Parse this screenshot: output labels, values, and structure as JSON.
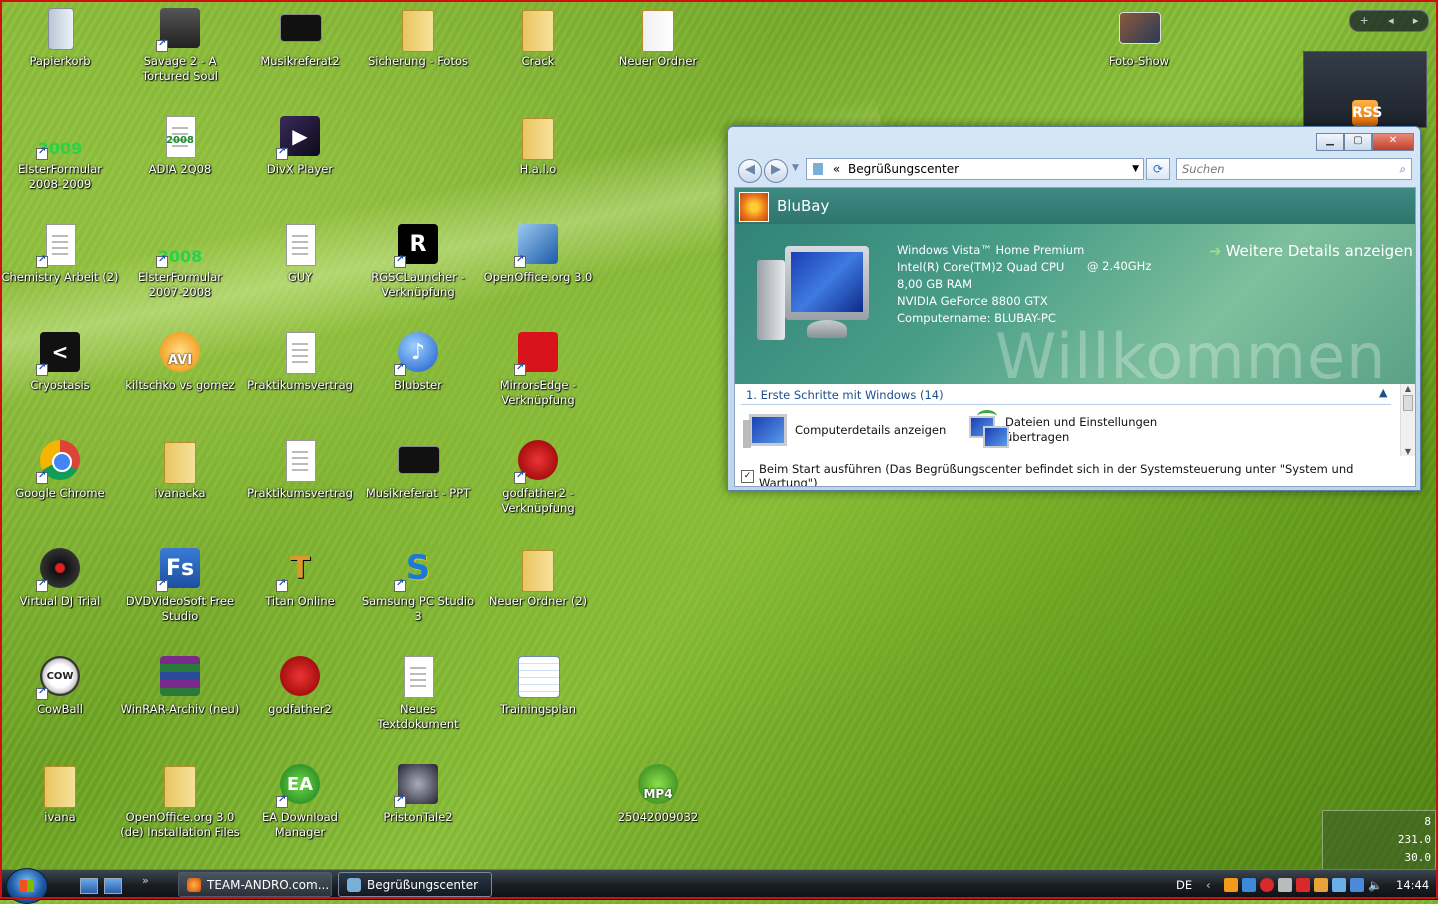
{
  "desktop": {
    "icons": [
      {
        "label": "Papierkorb"
      },
      {
        "label": "Savage 2 - A Tortured Soul"
      },
      {
        "label": "Musikreferat2"
      },
      {
        "label": "Sicherung - Fotos"
      },
      {
        "label": "Crack"
      },
      {
        "label": "Neuer Ordner"
      },
      {
        "label": "Foto-Show"
      },
      {
        "label": "ElsterFormular 2008-2009"
      },
      {
        "label": "ADIA 2Q08"
      },
      {
        "label": "DivX Player"
      },
      {
        "label": "H.a.l.o"
      },
      {
        "label": "Chemistry Arbeit (2)"
      },
      {
        "label": "ElsterFormular 2007-2008"
      },
      {
        "label": "GUY"
      },
      {
        "label": "RGSCLauncher - Verknüpfung"
      },
      {
        "label": "OpenOffice.org 3.0"
      },
      {
        "label": "Cryostasis"
      },
      {
        "label": "kiltschko vs gomez"
      },
      {
        "label": "Praktikumsvertrag"
      },
      {
        "label": "Blubster"
      },
      {
        "label": "MirrorsEdge - Verknüpfung"
      },
      {
        "label": "Google Chrome"
      },
      {
        "label": "ivanacka"
      },
      {
        "label": "Praktikumsvertrag"
      },
      {
        "label": "Musikreferat - PPT"
      },
      {
        "label": "godfather2 - Verknüpfung"
      },
      {
        "label": "Virtual DJ Trial"
      },
      {
        "label": "DVDVideoSoft Free Studio"
      },
      {
        "label": "Titan Online"
      },
      {
        "label": "Samsung PC Studio 3"
      },
      {
        "label": "Neuer Ordner (2)"
      },
      {
        "label": "CowBall"
      },
      {
        "label": "WinRAR-Archiv (neu)"
      },
      {
        "label": "godfather2"
      },
      {
        "label": "Neues Textdokument"
      },
      {
        "label": "Trainingsplan"
      },
      {
        "label": "ivana"
      },
      {
        "label": "OpenOffice.org 3.0 (de) Installation Files"
      },
      {
        "label": "EA Download Manager"
      },
      {
        "label": "PristonTale2"
      },
      {
        "label": "25042009032"
      }
    ],
    "icon_glyphs": {
      "elster_year_1": "2009",
      "adia_year": "2008",
      "elster_year_2": "2008",
      "avi": "AVI",
      "fs": "Fs",
      "mp4": "MP4",
      "cow": "COW",
      "ea": "EA"
    }
  },
  "window": {
    "title": "Begrüßungscenter",
    "address_prefix": "«",
    "address": "Begrüßungscenter",
    "search_placeholder": "Suchen",
    "user_name": "BluBay",
    "specs": {
      "os": "Windows Vista™ Home Premium",
      "cpu": "Intel(R) Core(TM)2 Quad CPU",
      "cpu_speed": "@ 2.40GHz",
      "ram": "8,00 GB RAM",
      "gpu": "NVIDIA GeForce 8800 GTX",
      "computer_name": "Computername: BLUBAY-PC"
    },
    "more_details": "Weitere Details anzeigen",
    "watermark": "Willkommen",
    "section_title": "1. Erste Schritte mit Windows (14)",
    "tasks": [
      {
        "label": "Computerdetails anzeigen"
      },
      {
        "label": "Dateien und Einstellungen übertragen"
      }
    ],
    "startup_checkbox": "Beim Start ausführen (Das Begrüßungscenter befindet sich in der Systemsteuerung unter \"System und Wartung\")",
    "startup_checked": true
  },
  "taskbar": {
    "buttons": [
      {
        "label": "TEAM-ANDRO.com...",
        "active": false
      },
      {
        "label": "Begrüßungscenter",
        "active": true
      }
    ],
    "language": "DE",
    "clock": "14:44"
  },
  "gadgets": {
    "meter": {
      "row1": "8",
      "row2": "231.0",
      "row3": "30.0"
    },
    "rss_label": "RSS"
  },
  "colors": {
    "accent": "#1e4e8c",
    "frame": "#d01010"
  }
}
